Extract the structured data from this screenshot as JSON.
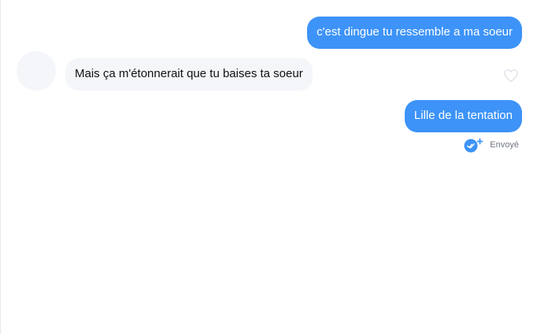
{
  "conversation": {
    "messages": [
      {
        "direction": "outgoing",
        "text": "c'est dingue tu ressemble a ma soeur"
      },
      {
        "direction": "incoming",
        "text": "Mais ça m'étonnerait que tu baises ta soeur"
      },
      {
        "direction": "outgoing",
        "text": "Lille de la tentation"
      }
    ],
    "status": {
      "label": "Envoyé",
      "icon": "sent-check-icon"
    },
    "incoming_avatar": "avatar",
    "like_icon": "heart-outline-icon"
  },
  "colors": {
    "outgoing_bubble": "#3d93f8",
    "incoming_bubble": "#f4f6f9",
    "status_text": "#6f7580"
  }
}
